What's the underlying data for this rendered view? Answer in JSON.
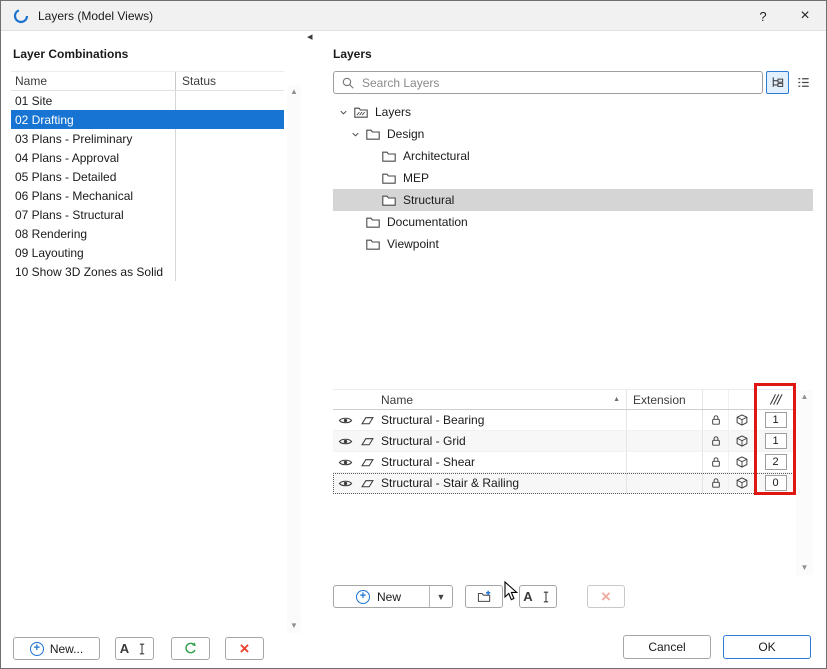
{
  "window": {
    "title": "Layers (Model Views)"
  },
  "glyphs": {
    "help": "?",
    "close": "×",
    "collapse": "◂",
    "sort_asc": "▲",
    "dropdown": "▼",
    "scroll_up": "▲",
    "scroll_down": "▼",
    "plus": "+",
    "cross": "×",
    "letter_a": "A"
  },
  "colors": {
    "selection_blue": "#1874d2",
    "tree_selection_gray": "#d5d5d5",
    "accent_blue": "#2b7cd3",
    "highlight_red": "#de1713",
    "delete_red": "#e8432f",
    "update_green": "#2f9e4a"
  },
  "left_panel": {
    "title": "Layer Combinations",
    "columns": [
      "Name",
      "Status"
    ],
    "rows": [
      {
        "name": "01 Site",
        "status": "",
        "selected": false
      },
      {
        "name": "02 Drafting",
        "status": "",
        "selected": true
      },
      {
        "name": "03 Plans - Preliminary",
        "status": "",
        "selected": false
      },
      {
        "name": "04 Plans - Approval",
        "status": "",
        "selected": false
      },
      {
        "name": "05 Plans - Detailed",
        "status": "",
        "selected": false
      },
      {
        "name": "06 Plans - Mechanical",
        "status": "",
        "selected": false
      },
      {
        "name": "07 Plans - Structural",
        "status": "",
        "selected": false
      },
      {
        "name": "08 Rendering",
        "status": "",
        "selected": false
      },
      {
        "name": "09 Layouting",
        "status": "",
        "selected": false
      },
      {
        "name": "10 Show 3D Zones as Solid",
        "status": "",
        "selected": false
      }
    ],
    "buttons": {
      "new": "New..."
    }
  },
  "right_panel": {
    "title": "Layers",
    "search": {
      "placeholder": "Search Layers",
      "value": ""
    },
    "tree": [
      {
        "label": "Layers",
        "level": 0,
        "expanded": true,
        "selected": false
      },
      {
        "label": "Design",
        "level": 1,
        "expanded": true,
        "selected": false
      },
      {
        "label": "Architectural",
        "level": 2,
        "selected": false
      },
      {
        "label": "MEP",
        "level": 2,
        "selected": false
      },
      {
        "label": "Structural",
        "level": 2,
        "selected": true
      },
      {
        "label": "Documentation",
        "level": 1,
        "selected": false
      },
      {
        "label": "Viewpoint",
        "level": 1,
        "selected": false
      }
    ],
    "table": {
      "columns": {
        "name": "Name",
        "extension": "Extension"
      },
      "rows": [
        {
          "name": "Structural - Bearing",
          "extension": "",
          "intersection_group": "1",
          "selected": false
        },
        {
          "name": "Structural - Grid",
          "extension": "",
          "intersection_group": "1",
          "selected": false
        },
        {
          "name": "Structural - Shear",
          "extension": "",
          "intersection_group": "2",
          "selected": false
        },
        {
          "name": "Structural - Stair & Railing",
          "extension": "",
          "intersection_group": "0",
          "selected": true
        }
      ]
    },
    "buttons": {
      "new": "New"
    }
  },
  "footer": {
    "cancel": "Cancel",
    "ok": "OK"
  }
}
